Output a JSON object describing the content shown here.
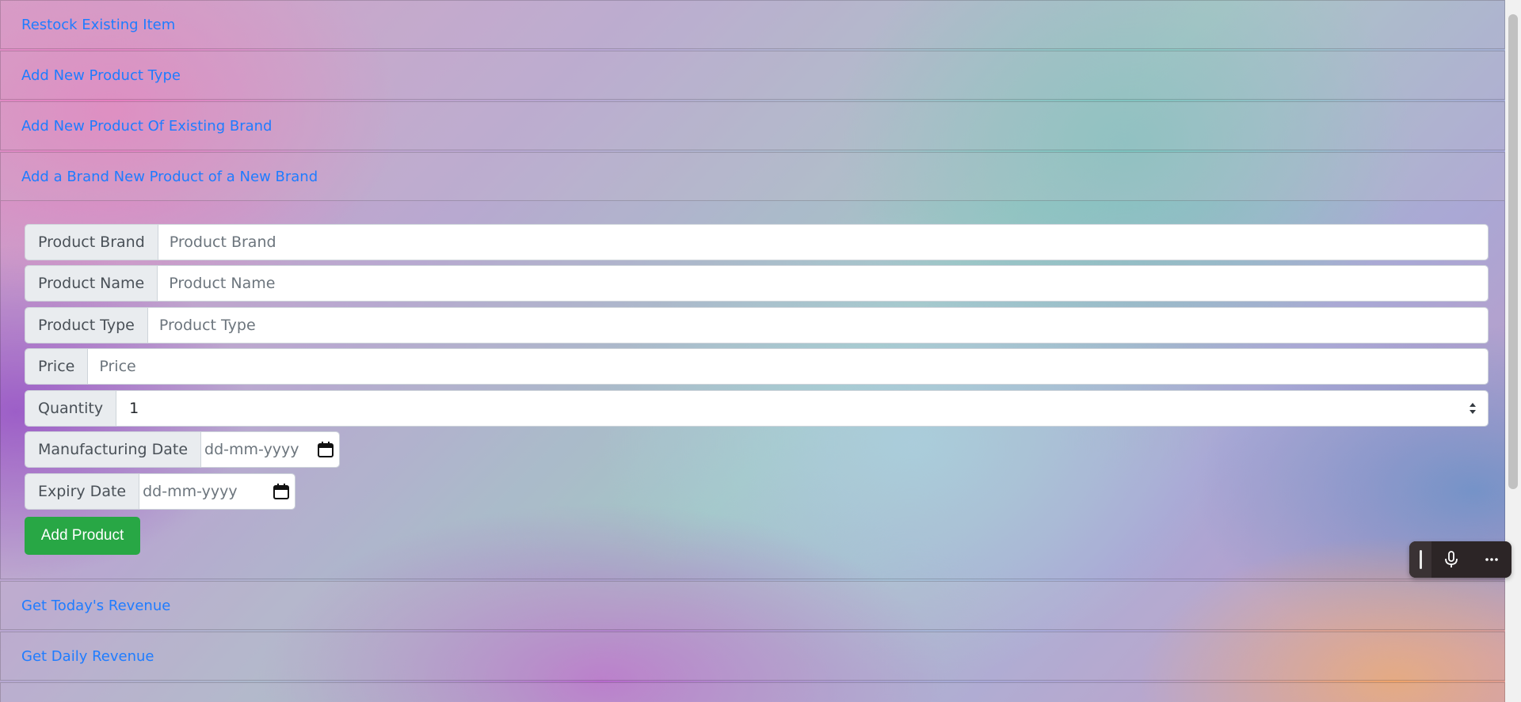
{
  "accordion": {
    "sections_top": [
      {
        "label": "Restock Existing Item"
      },
      {
        "label": "Add New Product Type"
      },
      {
        "label": "Add New Product Of Existing Brand"
      },
      {
        "label": "Add a Brand New Product of a New Brand"
      }
    ],
    "sections_bottom": [
      {
        "label": "Get Today's Revenue"
      },
      {
        "label": "Get Daily Revenue"
      }
    ]
  },
  "form": {
    "product_brand": {
      "label": "Product Brand",
      "placeholder": "Product Brand"
    },
    "product_name": {
      "label": "Product Name",
      "placeholder": "Product Name"
    },
    "product_type": {
      "label": "Product Type",
      "placeholder": "Product Type"
    },
    "price": {
      "label": "Price",
      "placeholder": "Price"
    },
    "quantity": {
      "label": "Quantity",
      "value": "1"
    },
    "manufacturing_date": {
      "label": "Manufacturing Date",
      "placeholder": "dd-mm-yyyy"
    },
    "expiry_date": {
      "label": "Expiry Date",
      "placeholder": "dd-mm-yyyy"
    },
    "submit_label": "Add Product"
  },
  "voice_toolbar": {
    "icons": [
      "drag-handle-icon",
      "microphone-icon",
      "more-options-icon"
    ]
  },
  "colors": {
    "link": "#1f7cff",
    "success": "#28a745",
    "addon_bg": "#e9ecef"
  }
}
